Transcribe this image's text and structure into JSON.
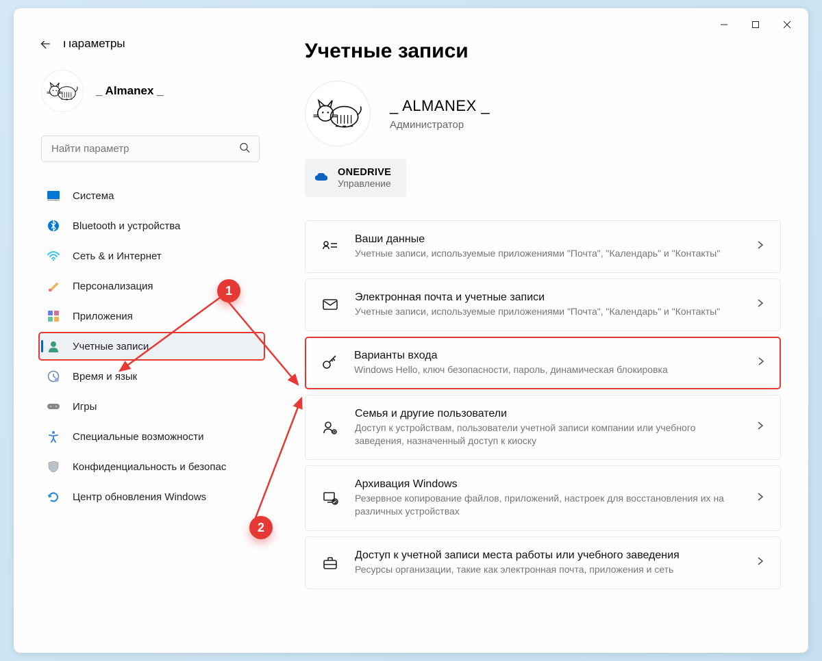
{
  "window": {
    "title": "Параметры"
  },
  "sidebar": {
    "user_name": "_ Almanex _",
    "search_placeholder": "Найти параметр",
    "items": [
      {
        "label": "Система"
      },
      {
        "label": "Bluetooth и устройства"
      },
      {
        "label": "Сеть & и Интернет"
      },
      {
        "label": "Персонализация"
      },
      {
        "label": "Приложения"
      },
      {
        "label": "Учетные записи"
      },
      {
        "label": "Время и язык"
      },
      {
        "label": "Игры"
      },
      {
        "label": "Специальные возможности"
      },
      {
        "label": "Конфиденциальность и безопас"
      },
      {
        "label": "Центр обновления Windows"
      }
    ]
  },
  "main": {
    "title": "Учетные записи",
    "profile_name": "_ ALMANEX _",
    "profile_role": "Администратор",
    "onedrive": {
      "title": "OneDrive",
      "sub": "Управление"
    },
    "cards": [
      {
        "title": "Ваши данные",
        "desc": "Учетные записи, используемые приложениями \"Почта\", \"Календарь\" и \"Контакты\""
      },
      {
        "title": "Электронная почта и учетные записи",
        "desc": "Учетные записи, используемые приложениями \"Почта\", \"Календарь\" и \"Контакты\""
      },
      {
        "title": "Варианты входа",
        "desc": "Windows Hello, ключ безопасности, пароль, динамическая блокировка"
      },
      {
        "title": "Семья и другие пользователи",
        "desc": "Доступ к устройствам, пользователи учетной записи компании или учебного заведения, назначенный доступ к киоску"
      },
      {
        "title": "Архивация Windows",
        "desc": "Резервное копирование файлов, приложений, настроек для восстановления их на различных устройствах"
      },
      {
        "title": "Доступ к учетной записи места работы или учебного заведения",
        "desc": "Ресурсы организации, такие как электронная почта, приложения и сеть"
      }
    ]
  },
  "annotations": {
    "badge1": "1",
    "badge2": "2"
  }
}
